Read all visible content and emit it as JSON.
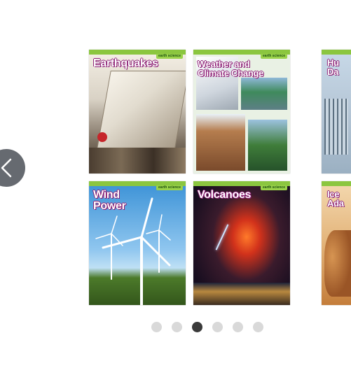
{
  "carousel": {
    "prev_button_icon": "chevron-left-icon",
    "books": [
      {
        "title": "Earthquakes",
        "series": "earth science"
      },
      {
        "title": "Weather and Climate Change",
        "title_line1": "Weather and",
        "title_line2": "Climate Change",
        "series": "earth science"
      },
      {
        "title_partial": "Hu Da",
        "line1": "Hu",
        "line2": "Da"
      },
      {
        "title": "Wind Power",
        "title_line1": "Wind",
        "title_line2": "Power",
        "series": "earth science"
      },
      {
        "title": "Volcanoes",
        "series": "earth science"
      },
      {
        "title_partial": "Ice Ada",
        "line1": "Ice",
        "line2": "Ada"
      }
    ],
    "pagination": {
      "count": 6,
      "active_index": 2
    }
  },
  "colors": {
    "accent_green": "#8bc63f",
    "title_outline": "#8a1b73",
    "prev_button": "#666a70",
    "dot_inactive": "#d9d9d9",
    "dot_active": "#3a3a3a"
  }
}
